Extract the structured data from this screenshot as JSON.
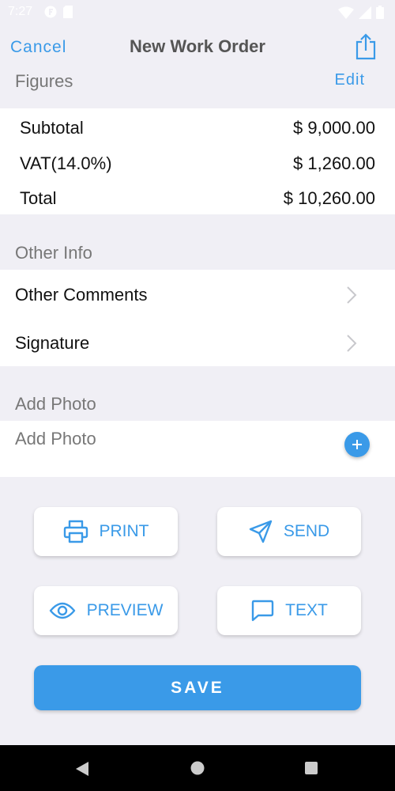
{
  "status": {
    "time": "7:27"
  },
  "header": {
    "cancel": "Cancel",
    "title": "New Work Order"
  },
  "figures": {
    "header": "Figures",
    "edit": "Edit",
    "rows": [
      {
        "label": "Subtotal",
        "value": "$ 9,000.00"
      },
      {
        "label": "VAT(14.0%)",
        "value": "$ 1,260.00"
      },
      {
        "label": "Total",
        "value": "$ 10,260.00"
      }
    ]
  },
  "other_info": {
    "header": "Other Info",
    "items": [
      {
        "label": "Other Comments"
      },
      {
        "label": "Signature"
      }
    ]
  },
  "photo": {
    "header": "Add Photo",
    "label": "Add Photo"
  },
  "actions": {
    "print": "PRINT",
    "send": "SEND",
    "preview": "PREVIEW",
    "text": "TEXT"
  },
  "save": "SAVE",
  "colors": {
    "accent": "#3a9ae8",
    "background": "#f0eff5",
    "card": "#ffffff"
  }
}
